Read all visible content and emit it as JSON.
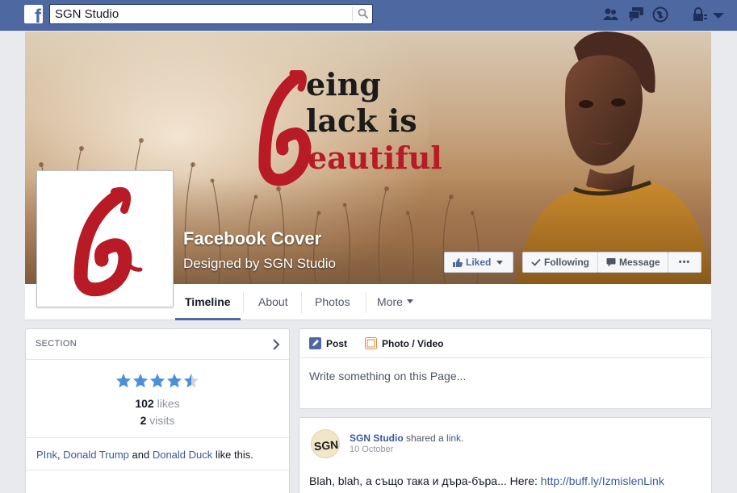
{
  "topbar": {
    "search_value": "SGN Studio",
    "icons": [
      "facebook-logo",
      "search-icon",
      "friend-requests-icon",
      "messages-icon",
      "notifications-icon",
      "privacy-icon",
      "settings-icon"
    ]
  },
  "cover": {
    "slogan_line1": "eing",
    "slogan_line2": "lack is",
    "slogan_line3": "eautiful",
    "title": "Facebook Cover",
    "subtitle": "Designed by SGN Studio",
    "accent_color": "#b81a26"
  },
  "actions": {
    "liked_label": "Liked",
    "following_label": "Following",
    "message_label": "Message",
    "more_label": "•••"
  },
  "tabs": [
    {
      "label": "Timeline",
      "active": true
    },
    {
      "label": "About"
    },
    {
      "label": "Photos"
    },
    {
      "label": "More"
    }
  ],
  "section_card": {
    "title": "SECTION",
    "rating": 4.5,
    "likes_count": "102",
    "likes_unit": "likes",
    "visits_count": "2",
    "visits_unit": "visits",
    "friend1": "PInk",
    "sep1": ", ",
    "friend2": "Donald Trump",
    "and_text": " and ",
    "friend3": "Donald Duck",
    "like_suffix": " like this."
  },
  "composer": {
    "post_tab": "Post",
    "photo_tab": "Photo / Video",
    "placeholder": "Write something on this Page..."
  },
  "post": {
    "author": "SGN Studio",
    "shared_text": " shared a ",
    "link_word": "link",
    "period": ".",
    "date": "10 October",
    "body_text": "Blah, blah, а също така и дъра-бъра... Here: ",
    "body_link": "http://buff.ly/IzmislenLink"
  },
  "colors": {
    "topbar": "#4e69a2",
    "link": "#3b5998",
    "star": "#4a90d9"
  }
}
